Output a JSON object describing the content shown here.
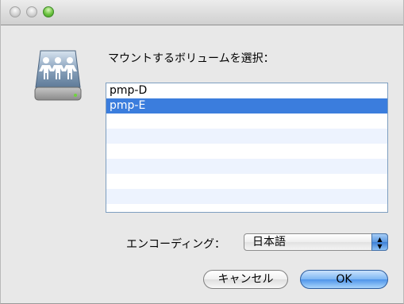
{
  "window": {
    "traffic_lights": [
      "close",
      "minimize",
      "zoom"
    ]
  },
  "icon": "shared-server-icon",
  "prompt": "マウントするボリュームを選択：",
  "volumes": {
    "items": [
      "pmp-D",
      "pmp-E",
      "",
      "",
      "",
      "",
      "",
      ""
    ],
    "selected": "pmp-E"
  },
  "encoding": {
    "label": "エンコーディング：",
    "selected": "日本語"
  },
  "buttons": {
    "cancel": "キャンセル",
    "ok": "OK"
  }
}
